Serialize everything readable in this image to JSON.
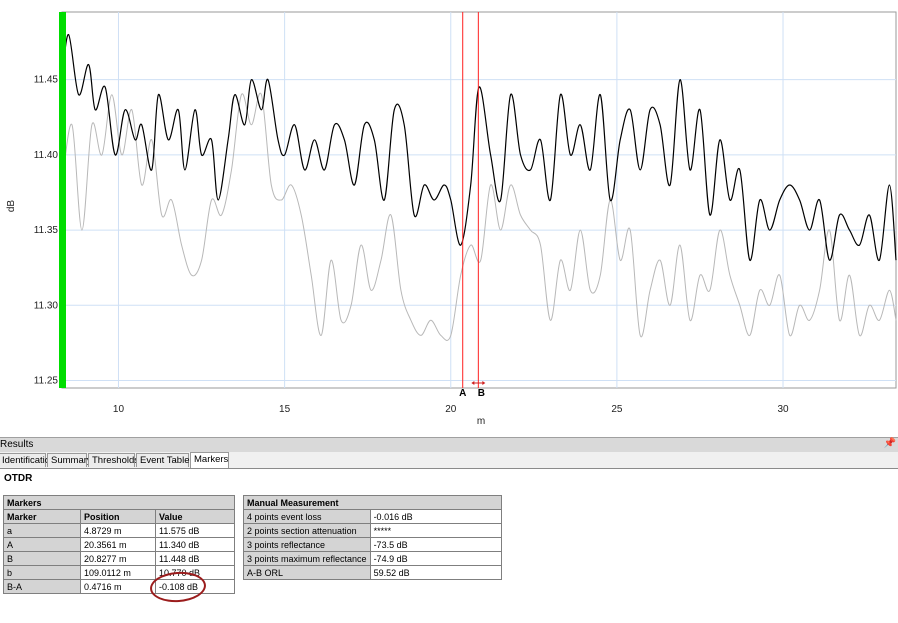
{
  "chart_data": {
    "type": "line",
    "xlabel": "m",
    "ylabel": "dB",
    "xlim": [
      8.3,
      33.4
    ],
    "ylim": [
      11.245,
      11.495
    ],
    "x_ticks": [
      10,
      15,
      20,
      25,
      30
    ],
    "y_ticks": [
      11.25,
      11.3,
      11.35,
      11.4,
      11.45
    ],
    "grid": true,
    "series": [
      {
        "color": "#000000",
        "x": [
          8.3,
          8.5,
          8.8,
          9.1,
          9.3,
          9.6,
          9.9,
          10.2,
          10.5,
          10.7,
          11.0,
          11.2,
          11.5,
          11.8,
          12.0,
          12.3,
          12.5,
          12.8,
          13.0,
          13.3,
          13.5,
          13.8,
          14.0,
          14.3,
          14.5,
          14.8,
          15.0,
          15.3,
          15.6,
          15.9,
          16.2,
          16.5,
          16.8,
          17.1,
          17.4,
          17.7,
          18.0,
          18.3,
          18.6,
          18.9,
          19.2,
          19.5,
          19.8,
          20.0,
          20.3,
          20.6,
          20.85,
          21.2,
          21.5,
          21.8,
          22.1,
          22.4,
          22.7,
          23.0,
          23.3,
          23.6,
          23.9,
          24.2,
          24.5,
          24.8,
          25.1,
          25.4,
          25.7,
          26.0,
          26.3,
          26.6,
          26.9,
          27.2,
          27.5,
          27.8,
          28.1,
          28.4,
          28.7,
          29.0,
          29.3,
          29.6,
          29.9,
          30.2,
          30.5,
          30.8,
          31.1,
          31.4,
          31.7,
          32.0,
          32.3,
          32.6,
          32.9,
          33.2,
          33.4
        ],
        "y": [
          11.45,
          11.48,
          11.44,
          11.46,
          11.43,
          11.445,
          11.4,
          11.43,
          11.41,
          11.42,
          11.39,
          11.44,
          11.41,
          11.43,
          11.39,
          11.43,
          11.4,
          11.41,
          11.37,
          11.41,
          11.44,
          11.42,
          11.45,
          11.43,
          11.45,
          11.41,
          11.4,
          11.42,
          11.39,
          11.41,
          11.39,
          11.42,
          11.41,
          11.38,
          11.42,
          11.41,
          11.37,
          11.43,
          11.42,
          11.36,
          11.38,
          11.37,
          11.38,
          11.37,
          11.34,
          11.38,
          11.445,
          11.4,
          11.37,
          11.44,
          11.4,
          11.39,
          11.41,
          11.37,
          11.44,
          11.4,
          11.42,
          11.39,
          11.44,
          11.37,
          11.41,
          11.43,
          11.39,
          11.43,
          11.42,
          11.38,
          11.45,
          11.39,
          11.43,
          11.36,
          11.41,
          11.37,
          11.39,
          11.33,
          11.37,
          11.35,
          11.37,
          11.38,
          11.37,
          11.35,
          11.37,
          11.33,
          11.36,
          11.35,
          11.34,
          11.36,
          11.33,
          11.38,
          11.33
        ]
      },
      {
        "color": "#b8b8b8",
        "x": [
          8.3,
          8.6,
          8.9,
          9.2,
          9.5,
          9.8,
          10.1,
          10.4,
          10.7,
          11.0,
          11.3,
          11.6,
          11.9,
          12.2,
          12.5,
          12.8,
          13.1,
          13.4,
          13.7,
          14.0,
          14.3,
          14.6,
          14.9,
          15.2,
          15.5,
          15.8,
          16.1,
          16.4,
          16.7,
          17.0,
          17.3,
          17.6,
          17.9,
          18.2,
          18.5,
          18.8,
          19.1,
          19.4,
          19.7,
          20.0,
          20.3,
          20.6,
          20.9,
          21.2,
          21.5,
          21.8,
          22.1,
          22.4,
          22.7,
          23.0,
          23.3,
          23.6,
          23.9,
          24.2,
          24.5,
          24.8,
          25.1,
          25.4,
          25.7,
          26.0,
          26.3,
          26.6,
          26.9,
          27.2,
          27.5,
          27.8,
          28.1,
          28.4,
          28.7,
          29.0,
          29.3,
          29.6,
          29.9,
          30.2,
          30.5,
          30.8,
          31.1,
          31.4,
          31.7,
          32.0,
          32.3,
          32.6,
          32.9,
          33.2,
          33.4
        ],
        "y": [
          11.38,
          11.42,
          11.35,
          11.42,
          11.4,
          11.44,
          11.4,
          11.43,
          11.38,
          11.41,
          11.36,
          11.37,
          11.34,
          11.32,
          11.33,
          11.37,
          11.36,
          11.39,
          11.44,
          11.42,
          11.44,
          11.38,
          11.37,
          11.38,
          11.36,
          11.32,
          11.28,
          11.33,
          11.29,
          11.3,
          11.34,
          11.31,
          11.33,
          11.36,
          11.31,
          11.29,
          11.28,
          11.29,
          11.28,
          11.28,
          11.32,
          11.34,
          11.33,
          11.38,
          11.35,
          11.38,
          11.36,
          11.35,
          11.34,
          11.29,
          11.33,
          11.31,
          11.35,
          11.31,
          11.32,
          11.37,
          11.33,
          11.35,
          11.28,
          11.31,
          11.33,
          11.3,
          11.34,
          11.29,
          11.32,
          11.31,
          11.35,
          11.32,
          11.3,
          11.28,
          11.31,
          11.3,
          11.32,
          11.28,
          11.3,
          11.29,
          11.31,
          11.35,
          11.29,
          11.32,
          11.28,
          11.3,
          11.29,
          11.31,
          11.29
        ]
      }
    ],
    "markers": [
      {
        "label": "A",
        "x": 20.36
      },
      {
        "label": "B",
        "x": 20.83
      }
    ]
  },
  "results_title": "Results",
  "pin_glyph": "📌",
  "tabs": [
    "Identification",
    "Summary",
    "Thresholds",
    "Event Table",
    "Markers"
  ],
  "active_tab": "Markers",
  "section_title": "OTDR",
  "markers_table": {
    "caption": "Markers",
    "headers": [
      "Marker",
      "Position",
      "Value"
    ],
    "rows": [
      [
        "a",
        "4.8729 m",
        "11.575 dB"
      ],
      [
        "A",
        "20.3561 m",
        "11.340 dB"
      ],
      [
        "B",
        "20.8277 m",
        "11.448 dB"
      ],
      [
        "b",
        "109.0112 m",
        "10.770 dB"
      ],
      [
        "B-A",
        "0.4716 m",
        "-0.108 dB"
      ]
    ]
  },
  "manual_table": {
    "caption": "Manual Measurement",
    "rows": [
      [
        "4 points event loss",
        "-0.016 dB"
      ],
      [
        "2 points section attenuation",
        "*****"
      ],
      [
        "3 points reflectance",
        "-73.5 dB"
      ],
      [
        "3 points maximum reflectance",
        "-74.9 dB"
      ],
      [
        "A-B ORL",
        "59.52 dB"
      ]
    ]
  }
}
